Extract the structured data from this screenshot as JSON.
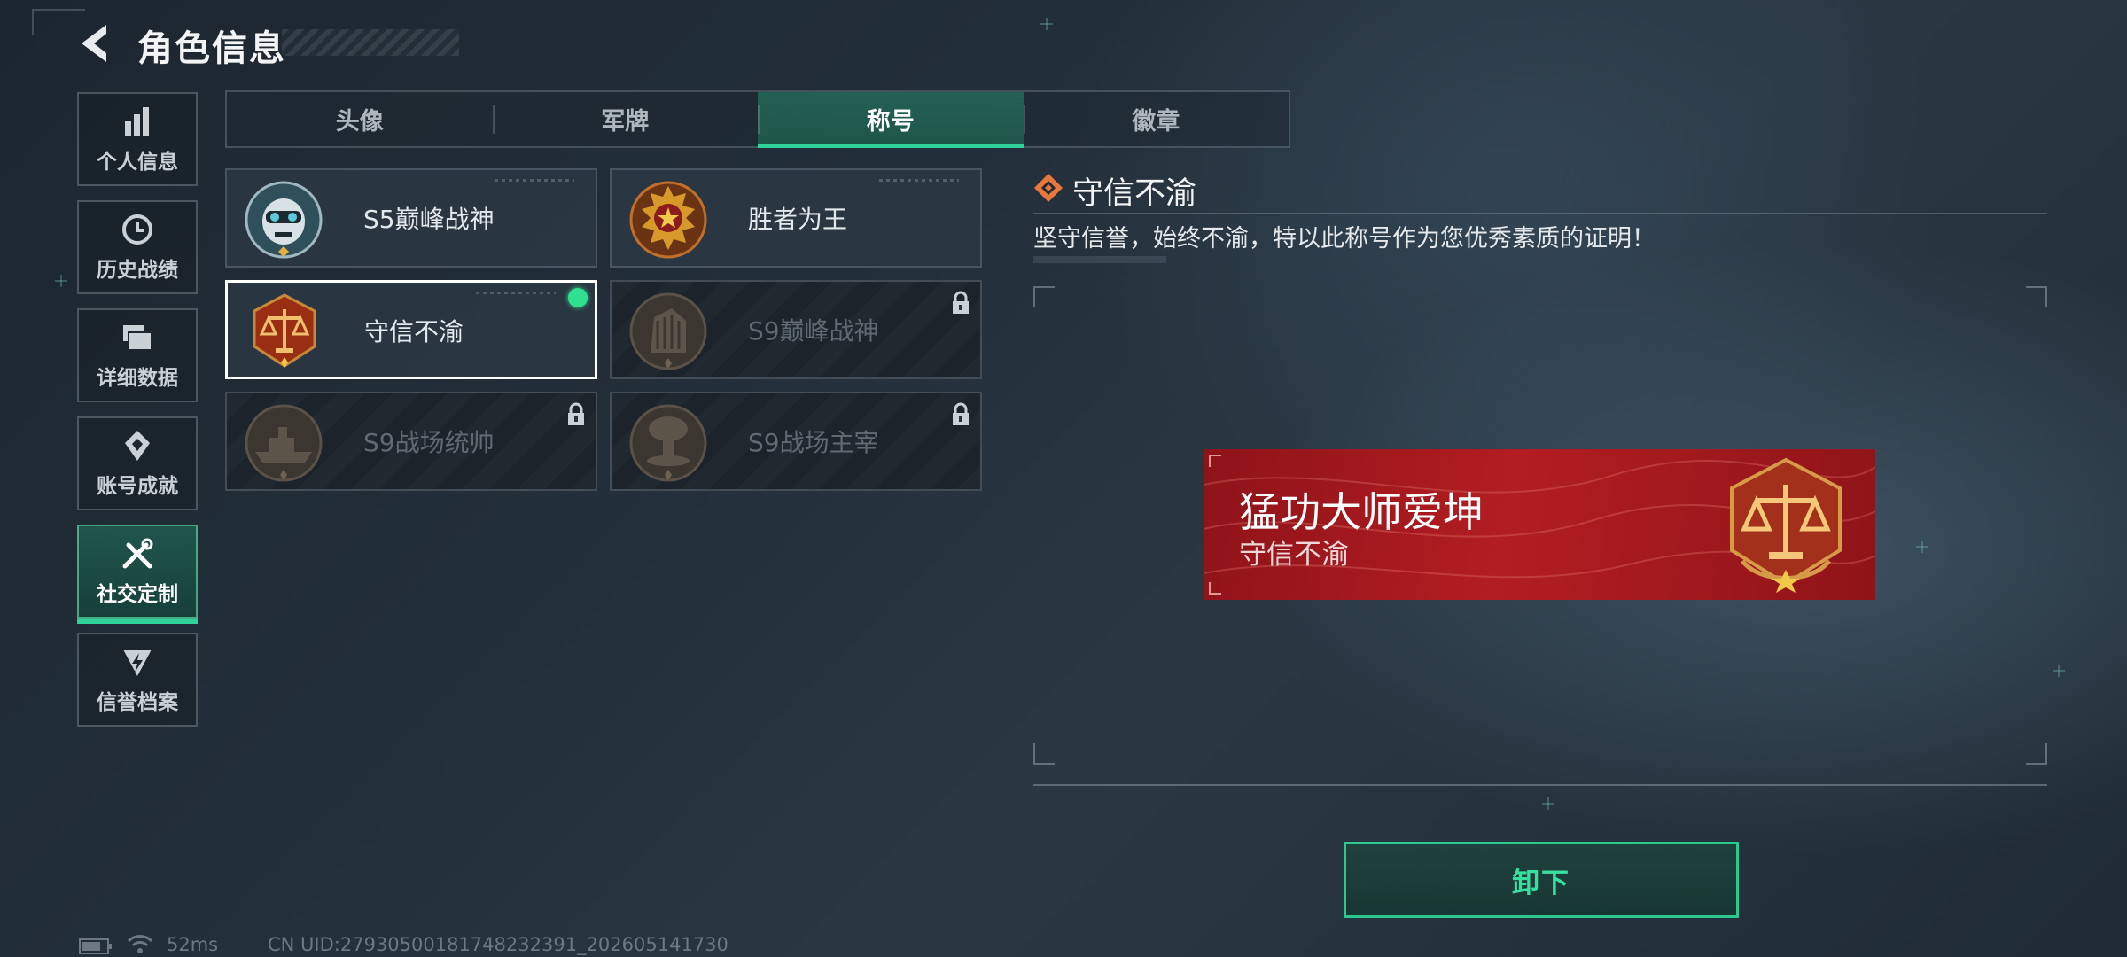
{
  "header": {
    "title": "角色信息"
  },
  "sidebar": {
    "items": [
      {
        "label": "个人信息",
        "icon": "bar-chart-icon",
        "active": false
      },
      {
        "label": "历史战绩",
        "icon": "history-clock-icon",
        "active": false
      },
      {
        "label": "详细数据",
        "icon": "folder-icon",
        "active": false
      },
      {
        "label": "账号成就",
        "icon": "achievement-icon",
        "active": false
      },
      {
        "label": "社交定制",
        "icon": "tools-icon",
        "active": true
      },
      {
        "label": "信誉档案",
        "icon": "reputation-icon",
        "active": false
      }
    ]
  },
  "tabs": [
    {
      "label": "头像",
      "active": false
    },
    {
      "label": "军牌",
      "active": false
    },
    {
      "label": "称号",
      "active": true
    },
    {
      "label": "徽章",
      "active": false
    }
  ],
  "titles": [
    {
      "name": "S5巅峰战神",
      "locked": false,
      "equipped": false,
      "emblem": "skull-helmet-emblem"
    },
    {
      "name": "胜者为王",
      "locked": false,
      "equipped": false,
      "emblem": "gold-medal-emblem"
    },
    {
      "name": "守信不渝",
      "locked": false,
      "equipped": true,
      "emblem": "scales-emblem"
    },
    {
      "name": "S9巅峰战神",
      "locked": true,
      "equipped": false,
      "emblem": "monument-emblem"
    },
    {
      "name": "S9战场统帅",
      "locked": true,
      "equipped": false,
      "emblem": "warship-emblem"
    },
    {
      "name": "S9战场主宰",
      "locked": true,
      "equipped": false,
      "emblem": "mushroom-cloud-emblem"
    }
  ],
  "detail": {
    "title": "守信不渝",
    "description": "坚守信誉，始终不渝，特以此称号作为您优秀素质的证明！",
    "icon": "diamond-icon"
  },
  "banner": {
    "player_name": "猛功大师爱坤",
    "title": "守信不渝",
    "emblem": "scales-emblem",
    "color": "#b21d22"
  },
  "actions": {
    "unequip_label": "卸下"
  },
  "status": {
    "ping": "52ms",
    "uid": "CN UID:279305001817482323​91_202605141730"
  },
  "colors": {
    "accent": "#2fd39a",
    "equipped": "#2ee08f"
  }
}
